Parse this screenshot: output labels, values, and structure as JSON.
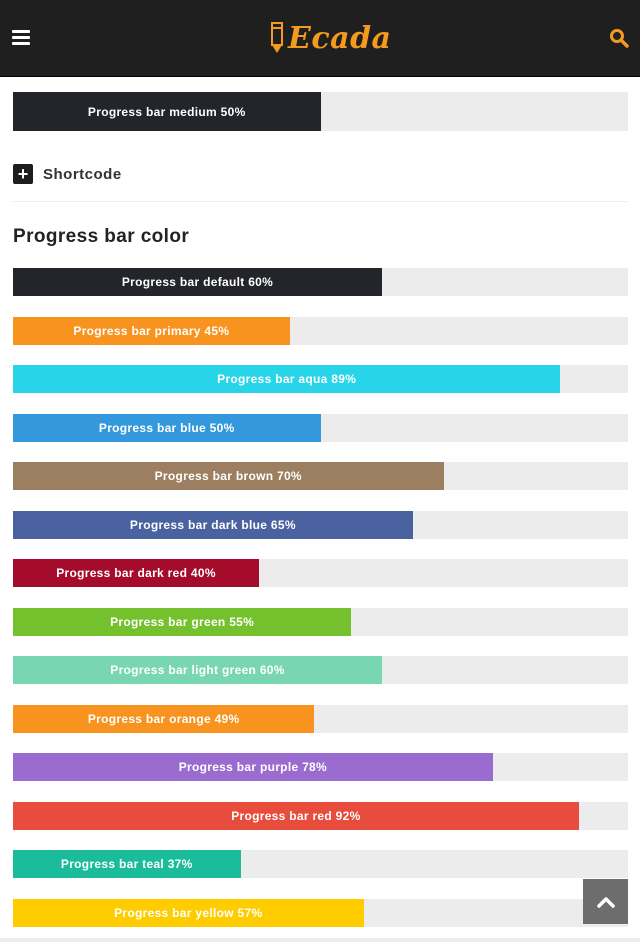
{
  "header": {
    "logo_text": "Ecada",
    "menu_icon": "hamburger-menu-icon",
    "search_icon": "search-icon",
    "background": "#1f1f1f",
    "accent": "#f49b1f"
  },
  "medium_bar": {
    "label": "Progress bar medium",
    "percent": "50%",
    "value": 50,
    "color": "#23252b"
  },
  "shortcode": {
    "label": "Shortcode",
    "icon": "plus-icon"
  },
  "section": {
    "title": "Progress bar color"
  },
  "bars": [
    {
      "label": "Progress bar default",
      "percent": "60%",
      "value": 60,
      "color": "#23252b"
    },
    {
      "label": "Progress bar primary",
      "percent": "45%",
      "value": 45,
      "color": "#f7931e"
    },
    {
      "label": "Progress bar aqua",
      "percent": "89%",
      "value": 89,
      "color": "#27d4e8"
    },
    {
      "label": "Progress bar blue",
      "percent": "50%",
      "value": 50,
      "color": "#3398dc"
    },
    {
      "label": "Progress bar brown",
      "percent": "70%",
      "value": 70,
      "color": "#9c7e60"
    },
    {
      "label": "Progress bar dark blue",
      "percent": "65%",
      "value": 65,
      "color": "#4a63a0"
    },
    {
      "label": "Progress bar dark red",
      "percent": "40%",
      "value": 40,
      "color": "#a50c2c"
    },
    {
      "label": "Progress bar green",
      "percent": "55%",
      "value": 55,
      "color": "#74c02d"
    },
    {
      "label": "Progress bar light green",
      "percent": "60%",
      "value": 60,
      "color": "#79d6b2"
    },
    {
      "label": "Progress bar orange",
      "percent": "49%",
      "value": 49,
      "color": "#f7931e"
    },
    {
      "label": "Progress bar purple",
      "percent": "78%",
      "value": 78,
      "color": "#9b6ccf"
    },
    {
      "label": "Progress bar red",
      "percent": "92%",
      "value": 92,
      "color": "#e74c3c"
    },
    {
      "label": "Progress bar teal",
      "percent": "37%",
      "value": 37,
      "color": "#1abc9c"
    },
    {
      "label": "Progress bar yellow",
      "percent": "57%",
      "value": 57,
      "color": "#ffcc00"
    }
  ],
  "scroll_top_icon": "chevron-up-icon"
}
